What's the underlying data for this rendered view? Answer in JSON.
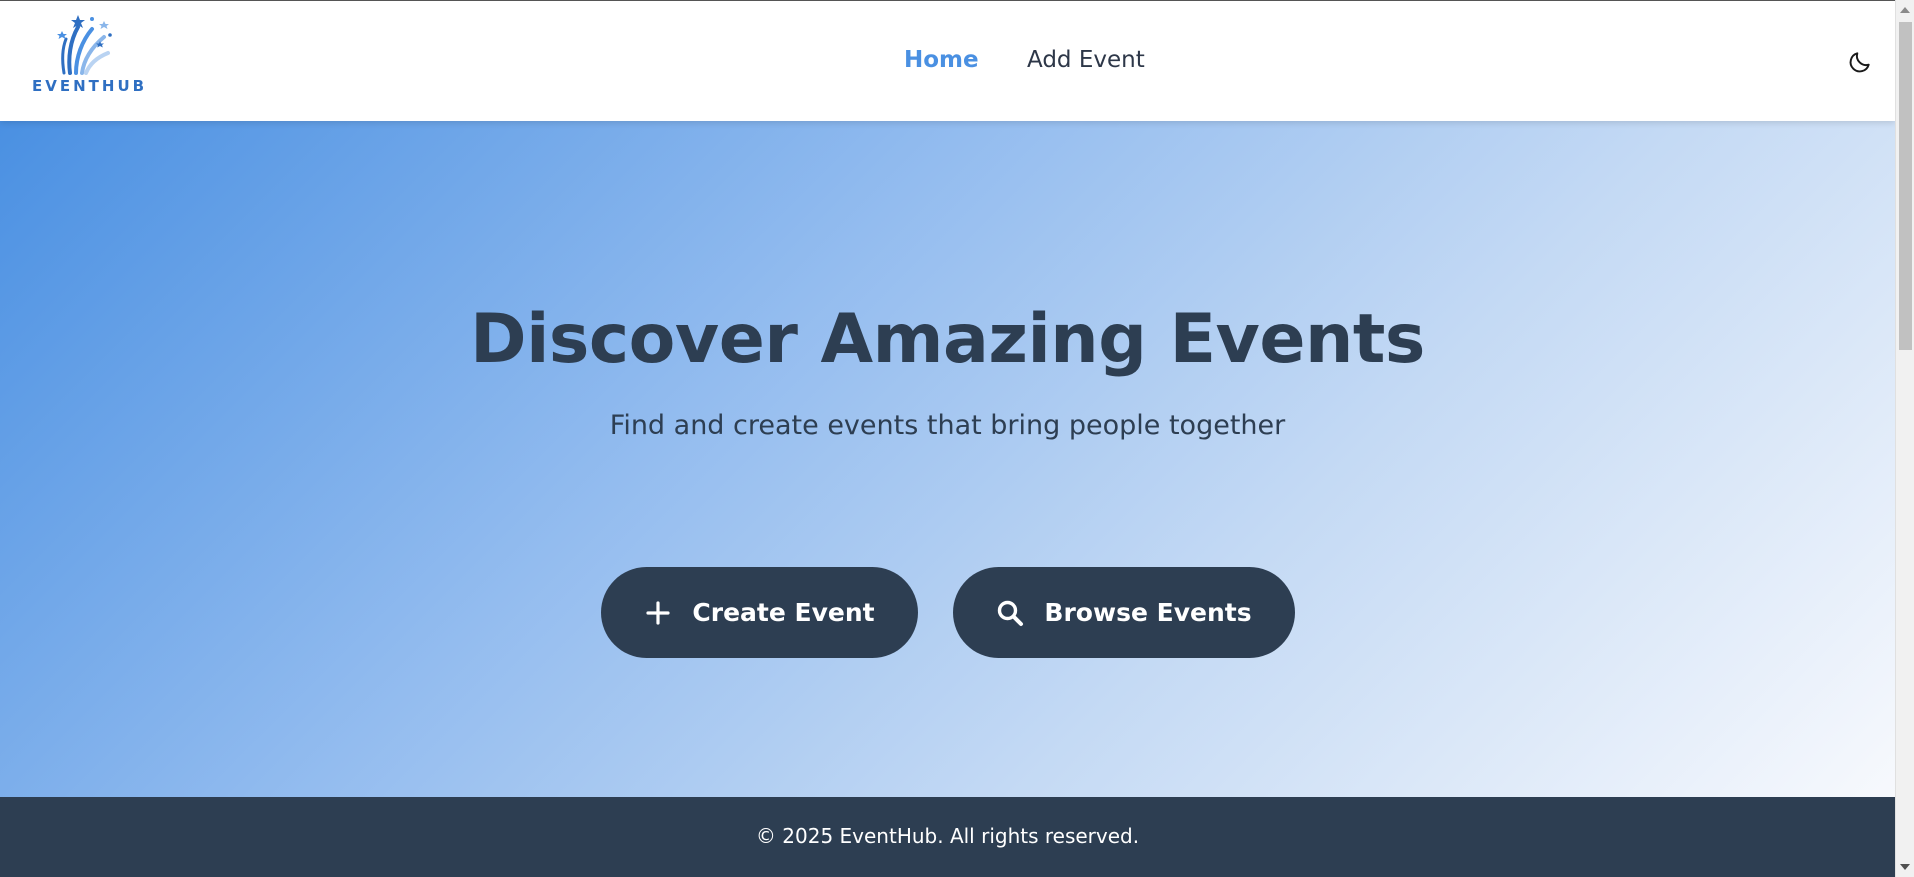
{
  "app": {
    "brand_name": "EVENTHUB",
    "logo_icon": "fireworks-logo-icon"
  },
  "nav": {
    "items": [
      {
        "label": "Home",
        "active": true
      },
      {
        "label": "Add Event",
        "active": false
      }
    ],
    "theme_toggle_icon": "moon-icon"
  },
  "hero": {
    "title": "Discover Amazing Events",
    "subtitle": "Find and create events that bring people together",
    "buttons": {
      "create": {
        "label": "Create Event",
        "icon": "plus-icon"
      },
      "browse": {
        "label": "Browse Events",
        "icon": "search-icon"
      }
    }
  },
  "footer": {
    "text": "© 2025 EventHub. All rights reserved."
  },
  "colors": {
    "primary": "#4a90e2",
    "dark": "#2d3e52",
    "logo_blue": "#2f6fc2",
    "white": "#ffffff"
  }
}
